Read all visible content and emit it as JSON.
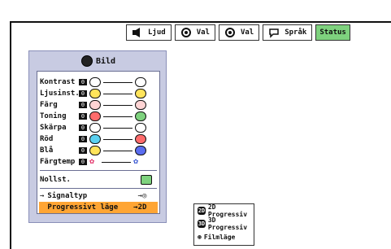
{
  "tabs": [
    {
      "label": "Ljud",
      "icon": "speaker-icon"
    },
    {
      "label": "Val",
      "icon": "gear-icon"
    },
    {
      "label": "Val",
      "icon": "gear-icon"
    },
    {
      "label": "Språk",
      "icon": "speech-icon"
    },
    {
      "label": "Status",
      "icon": "none"
    }
  ],
  "menu": {
    "title": "Bild",
    "items": [
      {
        "label": "Kontrast",
        "value": "0"
      },
      {
        "label": "Ljusinst.",
        "value": "0"
      },
      {
        "label": "Färg",
        "value": "0"
      },
      {
        "label": "Toning",
        "value": "0"
      },
      {
        "label": "Skärpa",
        "value": "0"
      },
      {
        "label": "Röd",
        "value": "0"
      },
      {
        "label": "Blå",
        "value": "0"
      },
      {
        "label": "Färgtemp",
        "value": "0"
      }
    ],
    "reset": "Nollst.",
    "signaltyp": "Signaltyp",
    "progressivt": "Progressivt läge"
  },
  "submenu": [
    {
      "label": "2D Progressiv",
      "badge": "2D"
    },
    {
      "label": "3D Progressiv",
      "badge": "3D"
    },
    {
      "label": "Filmläge",
      "badge": ""
    }
  ],
  "colors": {
    "menu_bg": "#c8cbe2",
    "highlight": "#ffa534",
    "status": "#7ed27e"
  }
}
